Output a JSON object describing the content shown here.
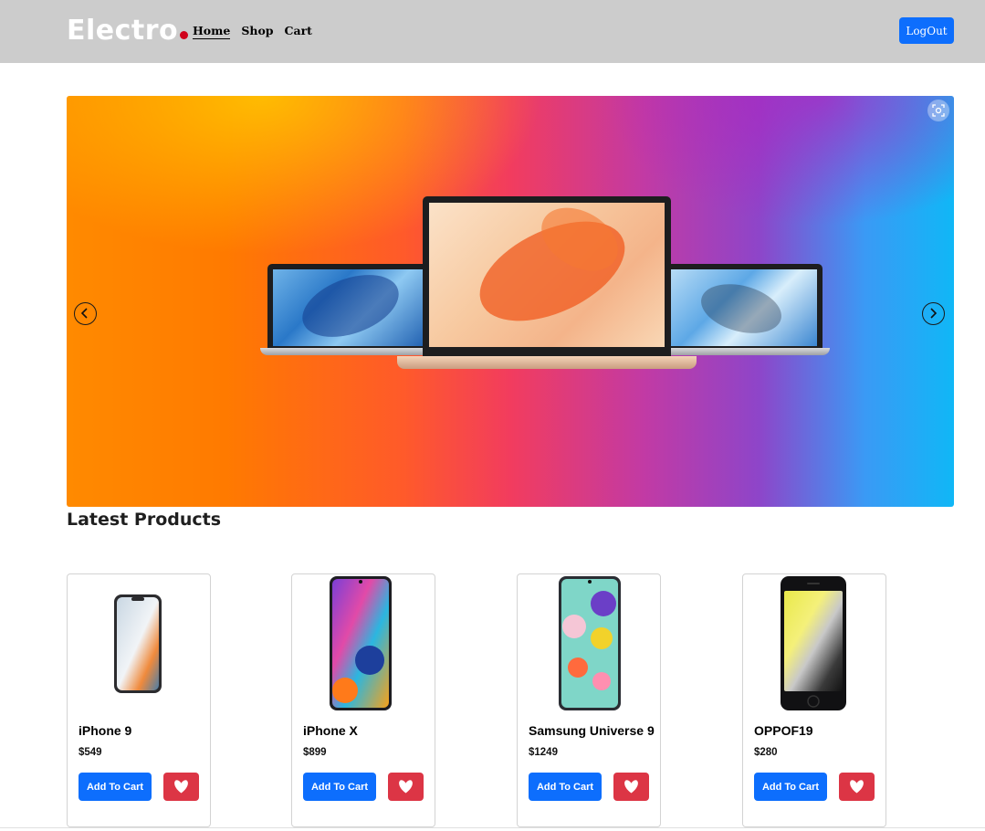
{
  "header": {
    "brand": "Electro",
    "nav": [
      {
        "label": "Home",
        "active": true
      },
      {
        "label": "Shop",
        "active": false
      },
      {
        "label": "Cart",
        "active": false
      }
    ],
    "logout_label": "LogOut"
  },
  "colors": {
    "navbar_bg": "#cccccc",
    "primary": "#0d6efd",
    "danger": "#dc3545",
    "brand_dot": "#d0021b"
  },
  "carousel": {
    "prev_icon": "chevron-left-icon",
    "next_icon": "chevron-right-icon",
    "lens_icon": "visual-search-icon"
  },
  "section": {
    "title": "Latest Products"
  },
  "products": [
    {
      "name": "iPhone 9",
      "price": "$549",
      "add_label": "Add To Cart",
      "fav_icon": "heart-icon",
      "image": "iphone-x-silver"
    },
    {
      "name": "iPhone X",
      "price": "$899",
      "add_label": "Add To Cart",
      "fav_icon": "heart-icon",
      "image": "samsung-a31-colorful"
    },
    {
      "name": "Samsung Universe 9",
      "price": "$1249",
      "add_label": "Add To Cart",
      "fav_icon": "heart-icon",
      "image": "samsung-a51-bubbles"
    },
    {
      "name": "OPPOF19",
      "price": "$280",
      "add_label": "Add To Cart",
      "fav_icon": "heart-icon",
      "image": "iphone-se-black"
    }
  ]
}
